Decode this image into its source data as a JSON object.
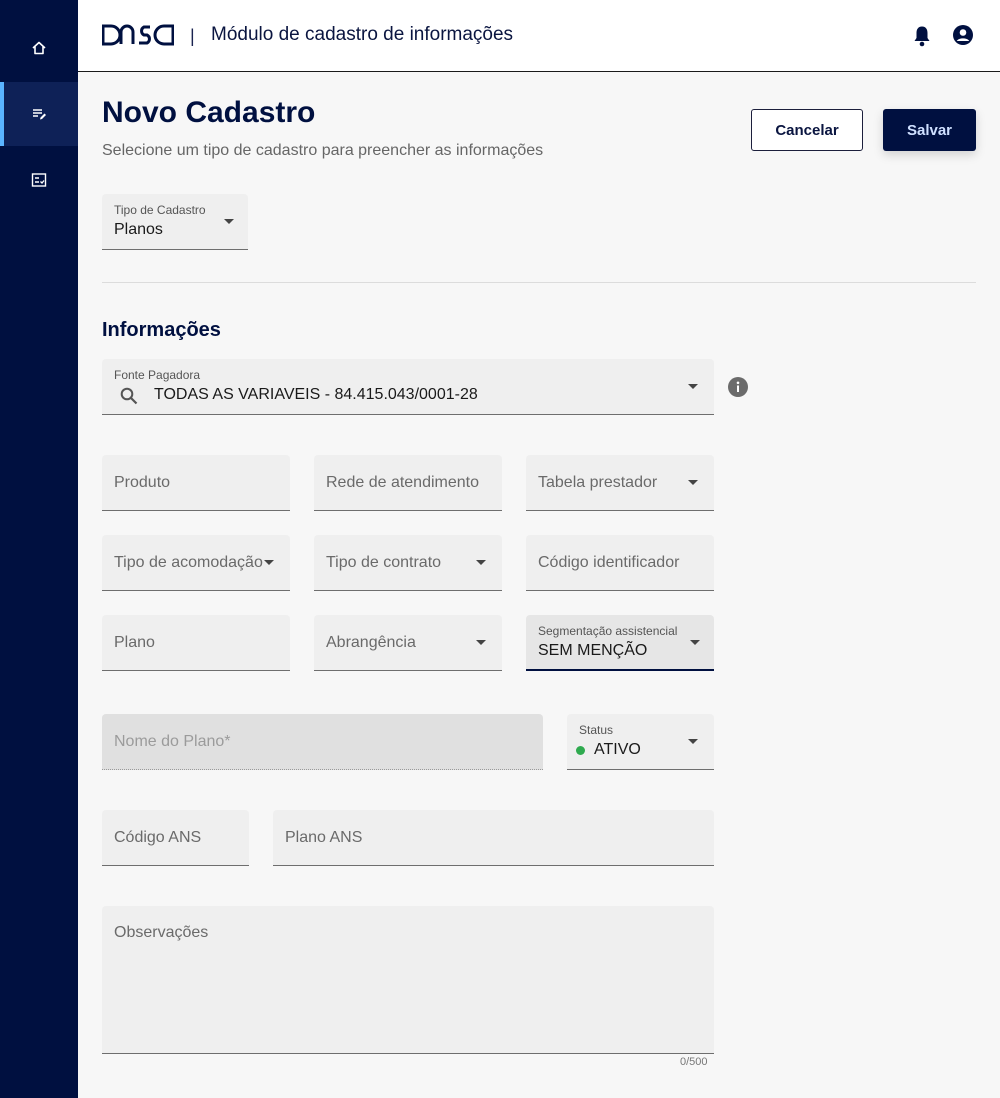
{
  "header": {
    "logo_text": "DASA",
    "separator": "|",
    "title": "Módulo de cadastro de informações"
  },
  "sidebar": {
    "items": [
      {
        "icon": "home-icon"
      },
      {
        "icon": "edit-list-icon",
        "active": true
      },
      {
        "icon": "checklist-icon"
      }
    ]
  },
  "page": {
    "title": "Novo Cadastro",
    "subtitle": "Selecione um tipo de cadastro para preencher as informações",
    "cancel_label": "Cancelar",
    "save_label": "Salvar"
  },
  "tipo_cadastro": {
    "label": "Tipo de Cadastro",
    "value": "Planos"
  },
  "section": {
    "title": "Informações"
  },
  "fonte_pagadora": {
    "label": "Fonte Pagadora",
    "value": "TODAS AS VARIAVEIS - 84.415.043/0001-28"
  },
  "fields": {
    "produto": "Produto",
    "rede": "Rede de atendimento",
    "tabela": "Tabela prestador",
    "acomodacao": "Tipo de acomodação",
    "contrato": "Tipo de contrato",
    "codigo_id": "Código identificador",
    "plano": "Plano",
    "abrangencia": "Abrangência",
    "nome_plano": "Nome do Plano*",
    "codigo_ans": "Código ANS",
    "plano_ans": "Plano ANS",
    "observacoes": "Observações"
  },
  "segmentacao": {
    "label": "Segmentação assistencial",
    "value": "SEM MENÇÃO"
  },
  "status": {
    "label": "Status",
    "value": "ATIVO",
    "color": "#2faa4f"
  },
  "observacoes_counter": "0/500",
  "colors": {
    "navy": "#001040",
    "field_bg": "#efefef",
    "accent": "#5ab4ff"
  }
}
